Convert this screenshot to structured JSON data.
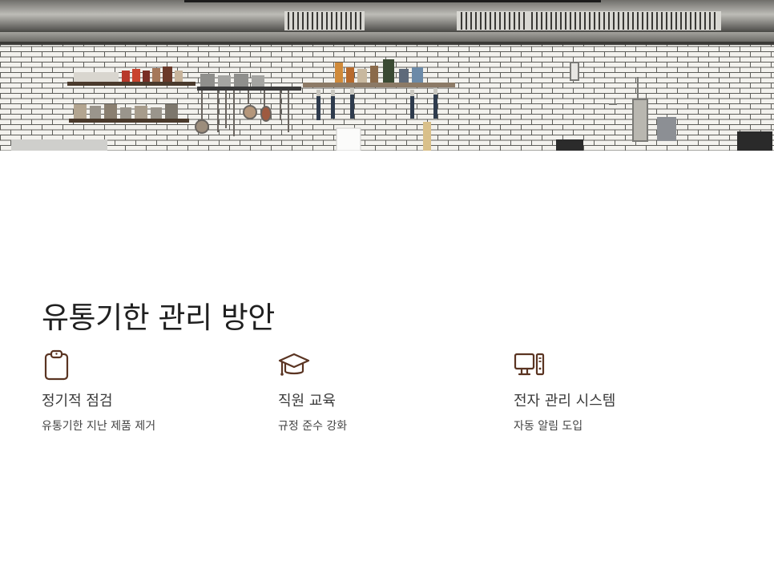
{
  "hero": {
    "image": "kitchen-photo"
  },
  "section": {
    "title": "유통기한 관리 방안"
  },
  "features": [
    {
      "icon": "clipboard-icon",
      "title": "정기적 점검",
      "description": "유통기한 지난 제품 제거"
    },
    {
      "icon": "graduation-cap-icon",
      "title": "직원 교육",
      "description": "규정 준수 강화"
    },
    {
      "icon": "computer-icon",
      "title": "전자 관리 시스템",
      "description": "자동 알림 도입"
    }
  ],
  "colors": {
    "icon_stroke": "#5a3422",
    "title_text": "#1f1f1f",
    "body_text": "#3a3a3a"
  }
}
